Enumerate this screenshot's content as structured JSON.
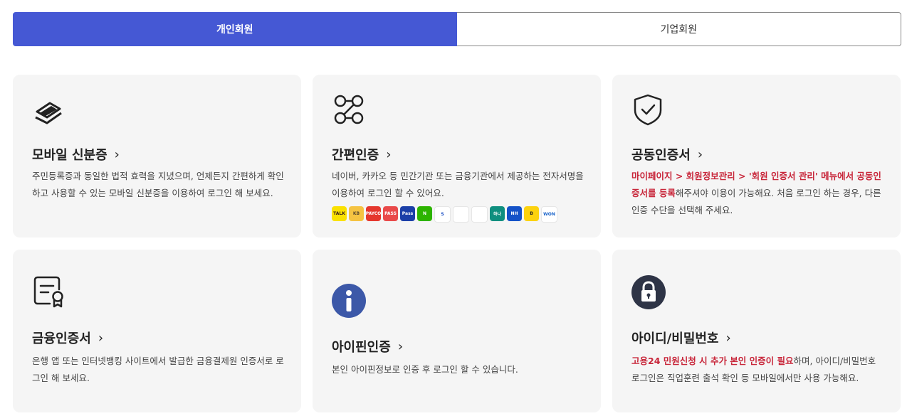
{
  "tabs": [
    {
      "label": "개인회원",
      "active": true
    },
    {
      "label": "기업회원",
      "active": false
    }
  ],
  "cards": [
    {
      "title": "모바일 신분증",
      "desc": "주민등록증과 동일한 법적 효력을 지녔으며, 언제든지 간편하게 확인하고 사용할 수 있는 모바일 신분증을 이용하여 로그인 해 보세요.",
      "icon": "mobile-id-icon"
    },
    {
      "title": "간편인증",
      "desc": "네이버, 카카오 등 민간기관 또는 금융기관에서 제공하는 전자서명을 이용하여 로그인 할 수 있어요.",
      "icon": "simple-auth-icon"
    },
    {
      "title": "공동인증서",
      "desc_red": "마이페이지 > 회원정보관리 > '회원 인증서 관리' 메뉴에서 공동인증서를 등록",
      "desc_rest": "해주셔야 이용이 가능해요. 처음 로그인 하는 경우, 다른 인증 수단을 선택해 주세요.",
      "icon": "shield-check-icon"
    },
    {
      "title": "금융인증서",
      "desc": "은행 앱 또는 인터넷뱅킹 사이트에서 발급한 금융결제원 인증서로 로그인 해 보세요.",
      "icon": "certificate-icon"
    },
    {
      "title": "아이핀인증",
      "desc": "본인 아이핀정보로 인증 후 로그인 할 수 있습니다.",
      "icon": "info-icon"
    },
    {
      "title": "아이디/비밀번호",
      "desc_red": "고용24 민원신청 시 추가 본인 인증이 필요",
      "desc_rest": "하며, 아이디/비밀번호 로그인은 직업훈련 출석 확인 등 모바일에서만 사용 가능해요.",
      "icon": "lock-icon"
    }
  ],
  "provider_logos": [
    {
      "name": "kakao-logo",
      "text": "TALK",
      "bg": "#fae100",
      "fg": "#3a1d1d"
    },
    {
      "name": "kb-logo",
      "text": "KB",
      "bg": "#f5c342",
      "fg": "#5b4a2e"
    },
    {
      "name": "payco-logo",
      "text": "PAYCO",
      "bg": "#e5372d",
      "fg": "#ffffff"
    },
    {
      "name": "pass-logo",
      "text": "PASS",
      "bg": "#e94a4a",
      "fg": "#ffffff"
    },
    {
      "name": "samsung-pass-logo",
      "text": "Pass",
      "bg": "#1b3fa8",
      "fg": "#ffffff"
    },
    {
      "name": "naver-logo",
      "text": "N",
      "bg": "#2db400",
      "fg": "#ffffff"
    },
    {
      "name": "shinhan-logo",
      "text": "S",
      "bg": "#ffffff",
      "fg": "#1a4fc4"
    },
    {
      "name": "toss-logo",
      "text": "",
      "bg": "#ffffff",
      "fg": "#1a73e8"
    },
    {
      "name": "banksalad-logo",
      "text": "",
      "bg": "#ffffff",
      "fg": "#28b4a0"
    },
    {
      "name": "hana-logo",
      "text": "하나",
      "bg": "#0f8f7f",
      "fg": "#ffffff"
    },
    {
      "name": "nh-logo",
      "text": "NH",
      "bg": "#1452c8",
      "fg": "#ffffff"
    },
    {
      "name": "banksign-logo",
      "text": "B",
      "bg": "#fcd20e",
      "fg": "#222222"
    },
    {
      "name": "woori-logo",
      "text": "WON",
      "bg": "#ffffff",
      "fg": "#1a63c9"
    }
  ]
}
